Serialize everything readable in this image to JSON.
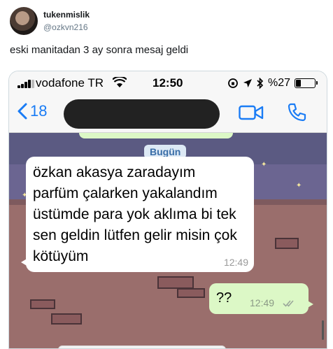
{
  "tweet": {
    "display_name": "tukenmislik",
    "handle": "@ozkvn216",
    "text": "eski manitadan 3 ay sonra mesaj geldi"
  },
  "phone": {
    "status_bar": {
      "carrier": "vodafone TR",
      "time": "12:50",
      "battery_text": "%27",
      "battery_level": 0.27
    },
    "nav": {
      "back_count": "18",
      "accent": "#1a7cf5"
    },
    "chat": {
      "date_label": "Bugün",
      "incoming": {
        "text": "özkan akasya zaradayım parfüm çalarken yakalandım üstümde para yok aklıma bi tek sen geldin lütfen gelir misin çok kötüyüm",
        "time": "12:49"
      },
      "outgoing": {
        "text": "??",
        "time": "12:49",
        "status_icon": "double-check-icon"
      }
    }
  }
}
